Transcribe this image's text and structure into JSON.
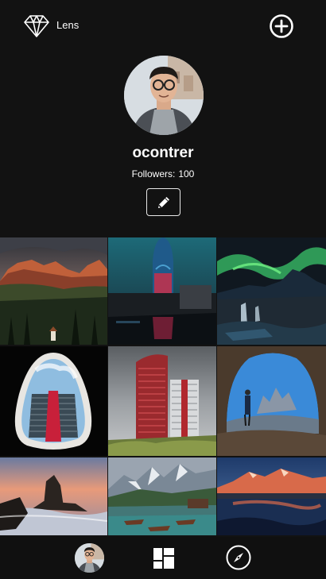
{
  "app": {
    "name": "Lens"
  },
  "header": {
    "logo_icon": "diamond-icon",
    "add_icon": "plus-circle-icon"
  },
  "profile": {
    "username": "ocontrer",
    "followers_label": "Followers:",
    "followers_count": "100",
    "edit_icon": "pencil-icon"
  },
  "photos": [
    {
      "subject": "dolomite-mountains-sunset"
    },
    {
      "subject": "torre-agbar-night"
    },
    {
      "subject": "aurora-kirkjufell-waterfall"
    },
    {
      "subject": "building-stairs-through-oval-frame"
    },
    {
      "subject": "red-tower-buildings"
    },
    {
      "subject": "cave-hiker-tre-cime"
    },
    {
      "subject": "sea-stack-sunset-coast"
    },
    {
      "subject": "braies-lake-boats"
    },
    {
      "subject": "mountain-lake-reflection-sunrise"
    }
  ],
  "bottom_nav": {
    "profile_icon": "avatar",
    "grid_icon": "grid-layout-icon",
    "explore_icon": "compass-icon"
  },
  "colors": {
    "background": "#121212",
    "text": "#ffffff"
  }
}
